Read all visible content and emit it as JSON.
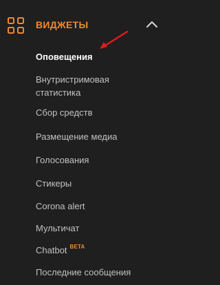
{
  "section": {
    "title": "ВИДЖЕТЫ",
    "icon": "grid-icon",
    "collapse_icon": "chevron-up-icon"
  },
  "menu": {
    "items": [
      {
        "label": "Оповещения",
        "active": true
      },
      {
        "label": "Внутристримовая статистика",
        "active": false
      },
      {
        "label": "Сбор средств",
        "active": false
      },
      {
        "label": "Размещение медиа",
        "active": false
      },
      {
        "label": "Голосования",
        "active": false
      },
      {
        "label": "Стикеры",
        "active": false
      },
      {
        "label": "Corona alert",
        "active": false
      },
      {
        "label": "Мультичат",
        "active": false
      },
      {
        "label": "Chatbot",
        "badge": "BETA",
        "active": false
      },
      {
        "label": "Последние сообщения",
        "active": false
      }
    ]
  },
  "annotation": {
    "arrow_icon": "red-arrow-icon",
    "color": "#e21b1b"
  },
  "colors": {
    "accent": "#f28a2d",
    "background": "#1f1f1f",
    "text": "#c2c2c2",
    "active_text": "#ffffff"
  }
}
